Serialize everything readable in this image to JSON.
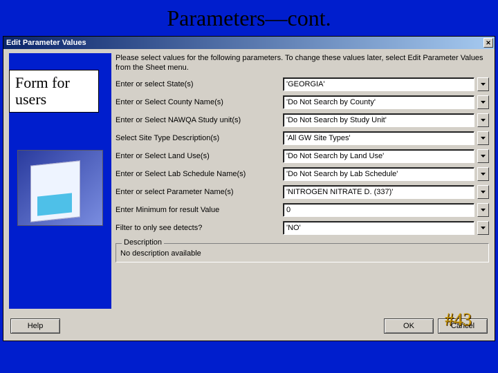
{
  "slide": {
    "title": "Parameters—cont.",
    "number": "#43"
  },
  "dialog": {
    "title": "Edit Parameter Values",
    "instructions": "Please select values for the following parameters. To change these values later, select Edit Parameter Values from the Sheet menu.",
    "rows": [
      {
        "label": "Enter or select State(s)",
        "value": "'GEORGIA'"
      },
      {
        "label": "Enter or Select County Name(s)",
        "value": "'Do Not Search by County'"
      },
      {
        "label": "Enter or Select NAWQA Study unit(s)",
        "value": "'Do Not Search by Study Unit'"
      },
      {
        "label": "Select Site Type Description(s)",
        "value": "'All GW Site Types'"
      },
      {
        "label": "Enter or Select Land Use(s)",
        "value": "'Do Not Search by Land Use'"
      },
      {
        "label": "Enter or Select Lab Schedule Name(s)",
        "value": "'Do Not Search by Lab Schedule'"
      },
      {
        "label": "Enter or select Parameter Name(s)",
        "value": "'NITROGEN NITRATE D. (337)'"
      },
      {
        "label": "Enter Minimum for result Value",
        "value": "0"
      },
      {
        "label": "Filter to only see detects?",
        "value": "'NO'"
      }
    ],
    "description": {
      "legend": "Description",
      "text": "No description available"
    },
    "buttons": {
      "help": "Help",
      "ok": "OK",
      "cancel": "Cancel"
    }
  },
  "annotation": "Form for users"
}
